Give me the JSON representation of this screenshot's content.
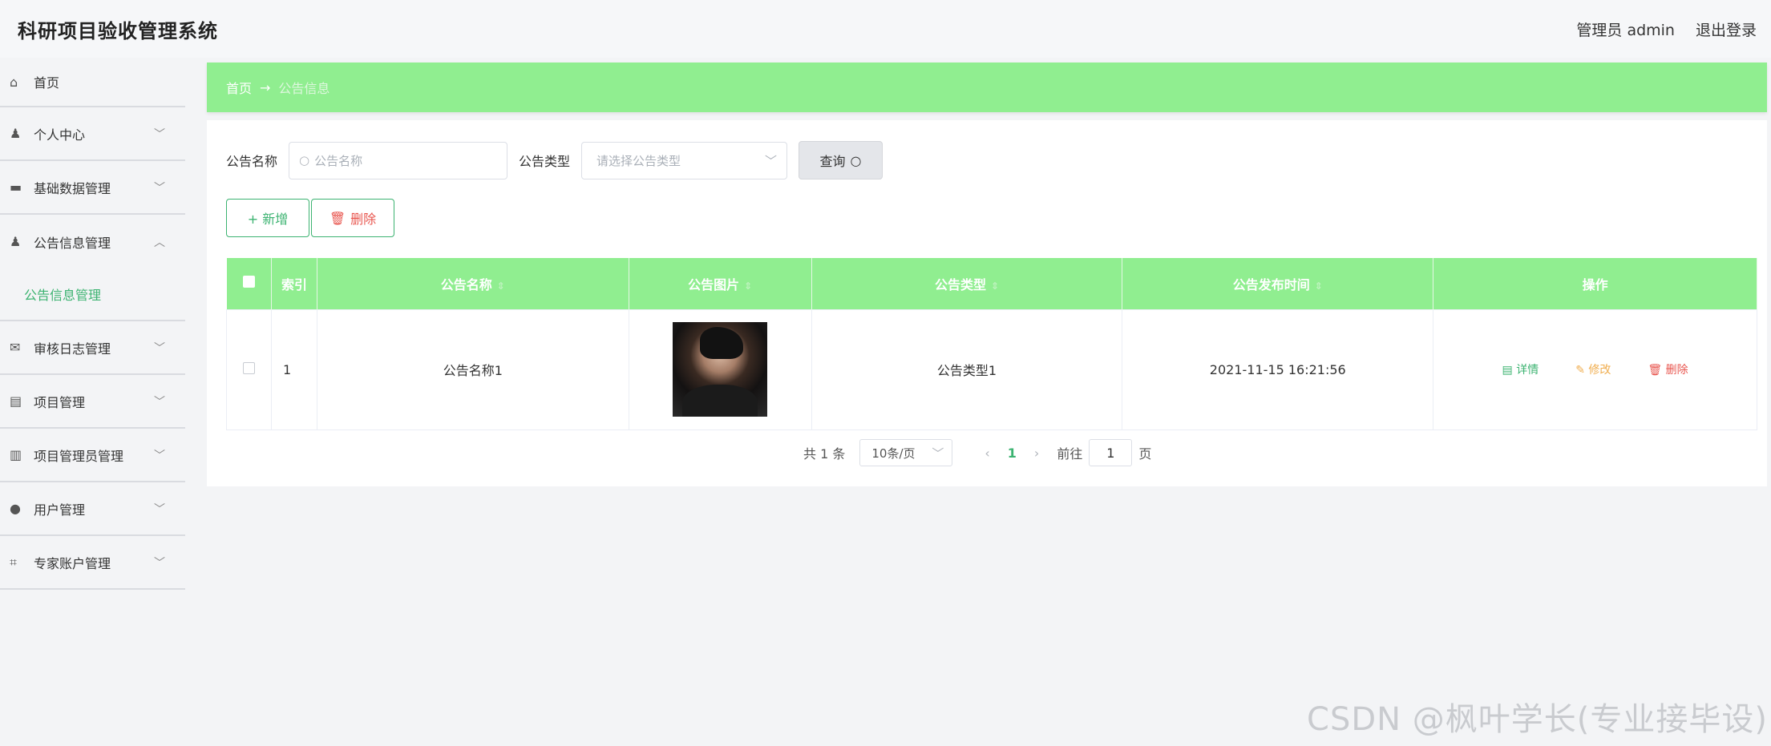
{
  "header": {
    "title": "科研项目验收管理系统",
    "user_label": "管理员 admin",
    "logout_label": "退出登录"
  },
  "sidebar": {
    "items": [
      {
        "label": "首页",
        "icon": "home-icon",
        "glyph": "⌂"
      },
      {
        "label": "个人中心",
        "icon": "user-icon",
        "glyph": "👤"
      },
      {
        "label": "基础数据管理",
        "icon": "monitor-icon",
        "glyph": "▬"
      },
      {
        "label": "公告信息管理",
        "icon": "person-icon",
        "glyph": "👤"
      },
      {
        "label": "审核日志管理",
        "icon": "mail-icon",
        "glyph": "✉"
      },
      {
        "label": "项目管理",
        "icon": "tag-icon",
        "glyph": "▤"
      },
      {
        "label": "项目管理员管理",
        "icon": "doc-icon",
        "glyph": "▥"
      },
      {
        "label": "用户管理",
        "icon": "location-icon",
        "glyph": "●"
      },
      {
        "label": "专家账户管理",
        "icon": "crop-icon",
        "glyph": "⌗"
      }
    ],
    "sub_item": "公告信息管理"
  },
  "breadcrumb": {
    "home": "首页",
    "arrow": "→",
    "current": "公告信息"
  },
  "search": {
    "name_label": "公告名称",
    "name_placeholder": "公告名称",
    "type_label": "公告类型",
    "type_placeholder": "请选择公告类型",
    "query_label": "查询"
  },
  "actions": {
    "add_label": "+ 新增",
    "delete_label": "删除"
  },
  "table": {
    "headers": [
      "索引",
      "公告名称",
      "公告图片",
      "公告类型",
      "公告发布时间",
      "操作"
    ],
    "rows": [
      {
        "index": "1",
        "name": "公告名称1",
        "type": "公告类型1",
        "time": "2021-11-15 16:21:56"
      }
    ],
    "ops": {
      "detail": "详情",
      "edit": "修改",
      "delete": "删除"
    }
  },
  "pagination": {
    "total": "共 1 条",
    "page_size": "10条/页",
    "current": "1",
    "goto_label": "前往",
    "goto_value": "1",
    "page_suffix": "页"
  },
  "watermark": "CSDN @枫叶学长(专业接毕设)",
  "colors": {
    "accent": "#90ee90",
    "green_text": "#3cb371",
    "danger": "#e8554e",
    "warning": "#f0ad4e"
  }
}
